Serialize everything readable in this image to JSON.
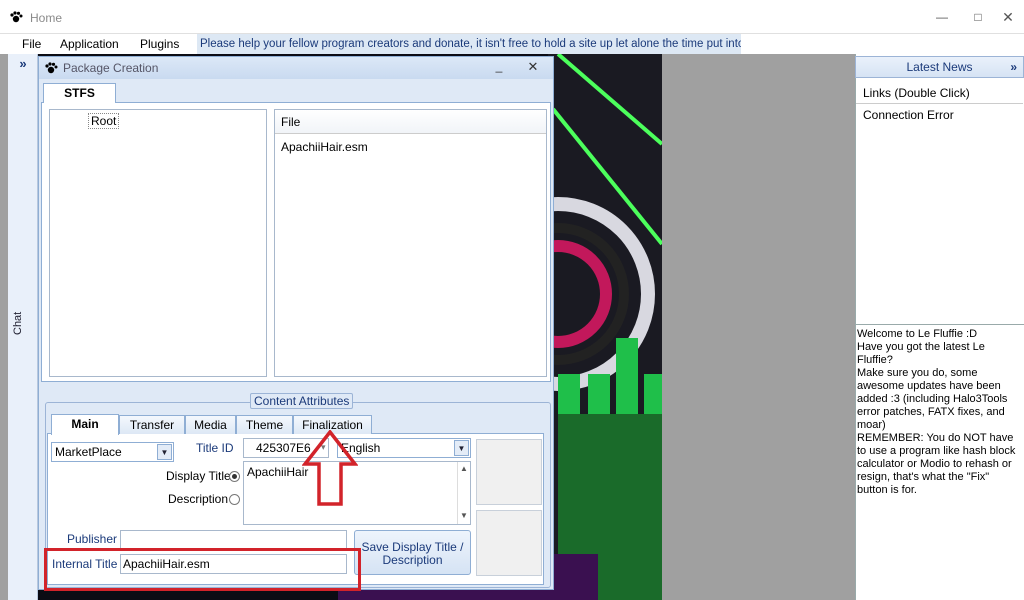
{
  "app": {
    "title": "Home"
  },
  "menu": {
    "items": [
      "File",
      "Application",
      "Plugins"
    ]
  },
  "donate": "Please help your fellow program creators and donate, it isn't free to hold a site up let alone the time put into this",
  "chat": {
    "expand": "»",
    "label": "Chat"
  },
  "news": {
    "header": "Latest News",
    "expand": "»",
    "links": "Links (Double Click)",
    "error": "Connection Error",
    "message": "Welcome to Le Fluffie :D\nHave you got the latest Le Fluffie?\nMake sure you do, some awesome updates have been added :3 (including Halo3Tools error patches, FATX fixes, and moar)\nREMEMBER: You do NOT have to use a program like hash block calculator or Modio to rehash or resign, that's what the \"Fix\" button is for."
  },
  "package": {
    "title": "Package Creation",
    "stfs_tab": "STFS",
    "tree_root": "Root",
    "file_header": "File",
    "files": [
      "ApachiiHair.esm"
    ],
    "content_attributes": "Content Attributes",
    "tabs": [
      "Main",
      "Transfer",
      "Media",
      "Theme",
      "Finalization"
    ],
    "package_type": "MarketPlace",
    "title_id_label": "Title ID",
    "title_id": "425307E6",
    "language": "English",
    "display_title_label": "Display Title",
    "description_label": "Description",
    "display_title_value": "ApachiiHair",
    "publisher_label": "Publisher",
    "publisher_value": "",
    "internal_title_label": "Internal Title",
    "internal_title_value": "ApachiiHair.esm",
    "save_button": "Save Display Title / Description"
  },
  "colors": {
    "annotation": "#d2232a",
    "accent": "#1b3a7a"
  }
}
